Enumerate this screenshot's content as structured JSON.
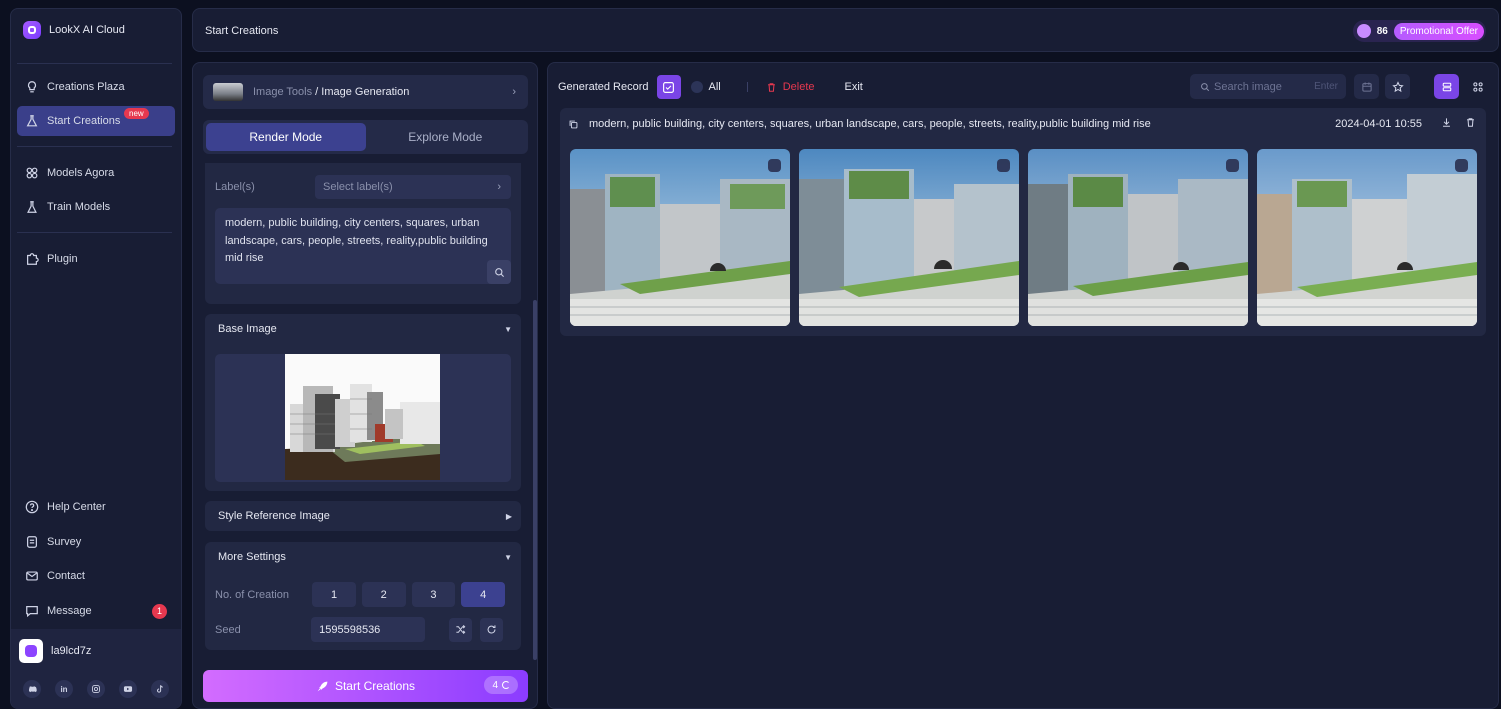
{
  "app": {
    "name": "LookX AI Cloud"
  },
  "sidebar": {
    "items": [
      {
        "label": "Creations Plaza",
        "icon": "bulb-icon"
      },
      {
        "label": "Start Creations",
        "icon": "flask-icon",
        "badge": "new"
      },
      {
        "label": "Models Agora",
        "icon": "models-icon"
      },
      {
        "label": "Train Models",
        "icon": "train-icon"
      },
      {
        "label": "Plugin",
        "icon": "puzzle-icon"
      }
    ],
    "bottom_items": [
      {
        "label": "Help Center",
        "icon": "help-icon"
      },
      {
        "label": "Survey",
        "icon": "survey-icon"
      },
      {
        "label": "Contact",
        "icon": "mail-icon"
      },
      {
        "label": "Message",
        "icon": "message-icon",
        "count": "1"
      }
    ],
    "user": {
      "name": "la9lcd7z"
    },
    "socials": [
      "discord-icon",
      "linkedin-icon",
      "instagram-icon",
      "youtube-icon",
      "tiktok-icon"
    ]
  },
  "header": {
    "title": "Start Creations",
    "credits": "86",
    "promo_label": "Promotional Offer"
  },
  "panel": {
    "breadcrumb_root": "Image Tools",
    "breadcrumb_sep": " / ",
    "breadcrumb_current": "Image Generation",
    "modes": [
      {
        "label": "Render Mode",
        "active": true
      },
      {
        "label": "Explore Mode",
        "active": false
      }
    ],
    "labels_label": "Label(s)",
    "labels_placeholder": "Select label(s)",
    "prompt": "modern, public building, city centers, squares, urban landscape, cars, people, streets, reality,public building mid rise",
    "base_image_title": "Base Image",
    "style_ref_title": "Style Reference Image",
    "more_settings_title": "More Settings",
    "creation_label": "No. of Creation",
    "creation_options": [
      "1",
      "2",
      "3",
      "4"
    ],
    "creation_selected": "4",
    "seed_label": "Seed",
    "seed_value": "1595598536",
    "start_label": "Start Creations",
    "start_count": "4"
  },
  "main": {
    "record_label": "Generated Record",
    "all_label": "All",
    "delete_label": "Delete",
    "exit_label": "Exit",
    "search_placeholder": "Search image",
    "search_hint": "Enter",
    "record": {
      "prompt": "modern, public building, city centers, squares, urban landscape, cars, people, streets, reality,public building mid rise",
      "date": "2024-04-01 10:55"
    }
  },
  "colors": {
    "accent": "#7a45e6",
    "danger": "#e6384f",
    "bg": "#0c1020",
    "panel": "#181d34"
  }
}
